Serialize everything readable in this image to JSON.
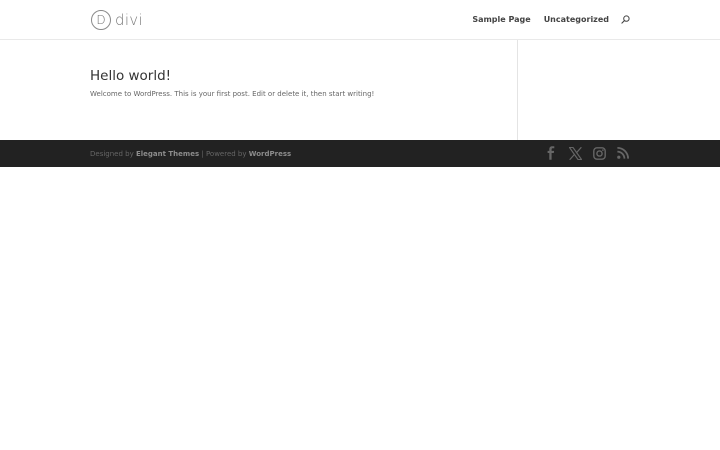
{
  "header": {
    "logo_letter": "D",
    "logo_text": "divi",
    "nav": [
      {
        "label": "Sample Page"
      },
      {
        "label": "Uncategorized"
      }
    ],
    "search_icon": "search-icon"
  },
  "post": {
    "title": "Hello world!",
    "excerpt": "Welcome to WordPress. This is your first post. Edit or delete it, then start writing!"
  },
  "footer": {
    "credits_prefix": "Designed by",
    "credits_theme": "Elegant Themes",
    "credits_separator": "| Powered by",
    "credits_platform": "WordPress",
    "social_icons": [
      "facebook-icon",
      "x-icon",
      "instagram-icon",
      "rss-icon"
    ]
  },
  "colors": {
    "footer_bg": "#222222",
    "text": "#666666",
    "icon": "#666666"
  }
}
